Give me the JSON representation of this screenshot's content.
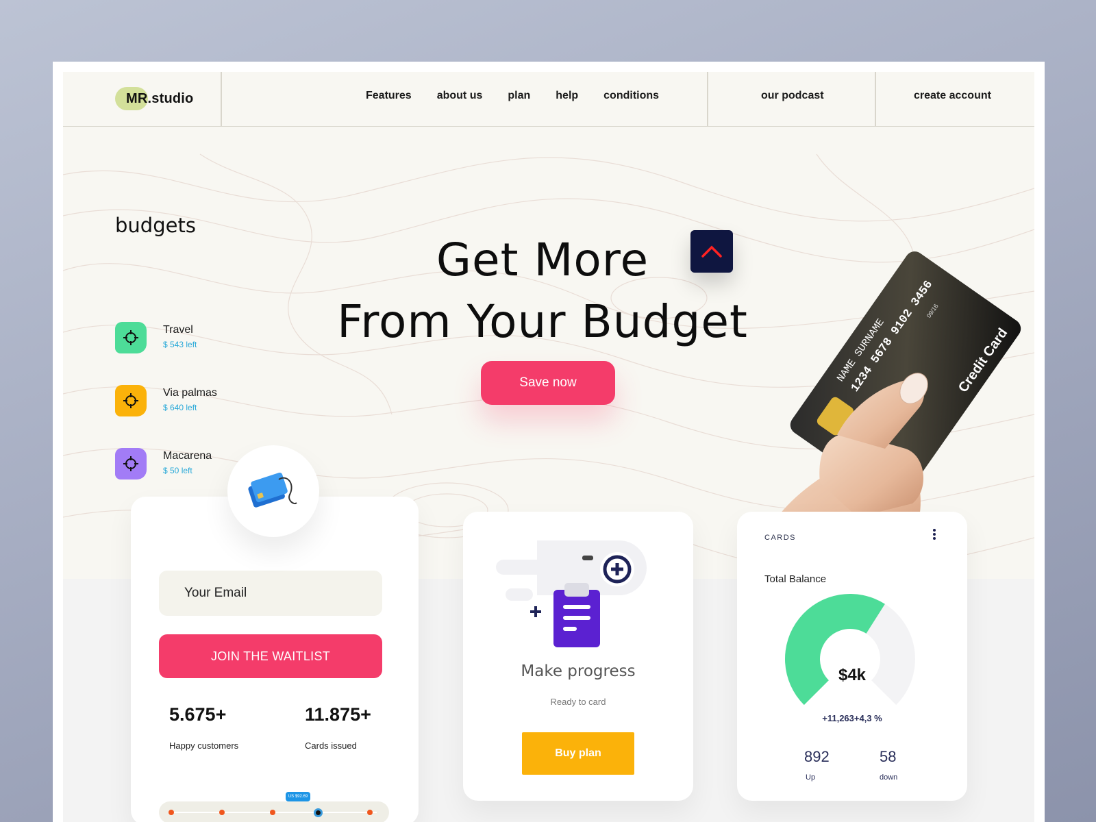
{
  "nav": {
    "logo": "MR.studio",
    "links": [
      "Features",
      "about us",
      "plan",
      "help",
      "conditions"
    ],
    "podcast": "our podcast",
    "create_account": "create account"
  },
  "budgets": {
    "title": "budgets",
    "items": [
      {
        "name": "Travel",
        "left": "$ 543 left",
        "color": "#4ddc98"
      },
      {
        "name": "Via palmas",
        "left": "$ 640 left",
        "color": "#fbb20a"
      },
      {
        "name": "Macarena",
        "left": "$ 50 left",
        "color": "#a27cf6"
      }
    ]
  },
  "hero": {
    "line1": "Get More",
    "line2": "From Your Budget",
    "cta": "Save now"
  },
  "credit_card": {
    "number": "1234 5678 9102 3456",
    "holder": "NAME SURNAME",
    "valid": "09/16",
    "label": "Credit Card"
  },
  "waitlist": {
    "email_placeholder": "Your Email",
    "join": "JOIN THE WAITLIST",
    "stats": [
      {
        "value": "5.675+",
        "label": "Happy customers"
      },
      {
        "value": "11.875+",
        "label": "Cards issued"
      }
    ],
    "slider_tip": "US $92.69"
  },
  "progress": {
    "title": "Make progress",
    "subtitle": "Ready to card",
    "buy": "Buy plan"
  },
  "balance": {
    "section": "CARDS",
    "title": "Total Balance",
    "value": "$4k",
    "delta": "+11,263+4,3 %",
    "gauge_fraction": 0.62,
    "up_value": "892",
    "up_label": "Up",
    "down_value": "58",
    "down_label": "down"
  },
  "colors": {
    "accent_pink": "#f43c6a",
    "accent_yellow": "#fbb20a",
    "gauge_green": "#4ddc98",
    "navy": "#0f1640"
  }
}
